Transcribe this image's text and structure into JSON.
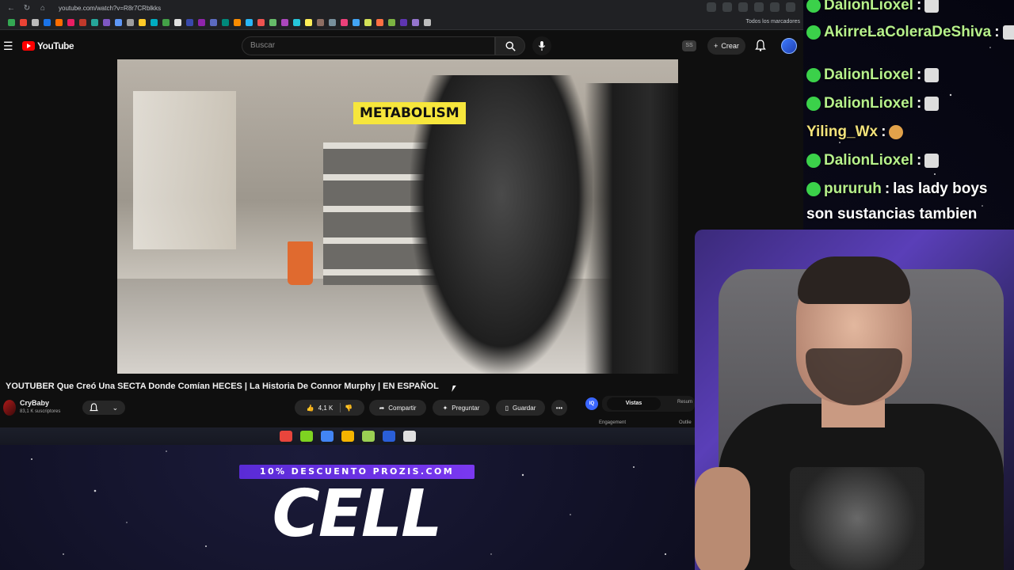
{
  "browser": {
    "url": "youtube.com/watch?v=R8r7CRblkks",
    "bookmarks_all_label": "Todos los marcadores",
    "bookmark_colors": [
      "#34a853",
      "#ea4335",
      "#bbbbbb",
      "#1a73e8",
      "#ff6d00",
      "#e91e63",
      "#c0392b",
      "#26a69a",
      "#7e57c2",
      "#5e97f6",
      "#9e9e9e",
      "#ffca28",
      "#00acc1",
      "#43a047",
      "#e0e0e0",
      "#3949ab",
      "#8e24aa",
      "#5c6bc0",
      "#00897b",
      "#fb8c00",
      "#29b6f6",
      "#ef5350",
      "#66bb6a",
      "#ab47bc",
      "#26c6da",
      "#ffee58",
      "#8d6e63",
      "#78909c",
      "#ec407a",
      "#42a5f5",
      "#d4e157",
      "#ff7043",
      "#7cb342",
      "#5e35b1",
      "#9575cd",
      "#bdbdbd"
    ]
  },
  "youtube": {
    "logo_text": "YouTube",
    "search_placeholder": "Buscar",
    "ss_badge": "SS",
    "create_label": "Crear",
    "video_overlay_text": "METABOLISM",
    "video_title": "YOUTUBER Que Creó Una SECTA Donde Comían HECES | La Historia De Connor Murphy | EN ESPAÑOL",
    "channel_name": "CryBaby",
    "subscribers": "83,1 K suscriptores",
    "likes": "4,1 K",
    "share_label": "Compartir",
    "ask_label": "Preguntar",
    "save_label": "Guardar",
    "more_label": "•••",
    "iq_badge": "IQ",
    "tab_views": "Vistas",
    "tab_summary": "Resum",
    "label_engagement": "Engagement",
    "label_outlier": "Outlie"
  },
  "taskbar": {
    "icon_colors": [
      "#e8453c",
      "#7ed321",
      "#4285f4",
      "#f5b400",
      "#9bcf53",
      "#2a5fd8",
      "#e0e0e0"
    ]
  },
  "promo": {
    "banner_text": "10% DESCUENTO PROZIS.COM",
    "big_text": "CELL"
  },
  "chat": {
    "messages": [
      {
        "user": "DalionLioxel",
        "text": "",
        "name_color": "green"
      },
      {
        "user": "AkirreLaColeraDeShiva",
        "text": "",
        "name_color": "green"
      },
      {
        "user": "DalionLioxel",
        "text": "",
        "name_color": "green"
      },
      {
        "user": "DalionLioxel",
        "text": "",
        "name_color": "green"
      },
      {
        "user": "Yiling_Wx",
        "text": "",
        "name_color": "yellow"
      },
      {
        "user": "DalionLioxel",
        "text": "",
        "name_color": "green"
      },
      {
        "user": "pururuh",
        "text": "las lady boys",
        "name_color": "green"
      }
    ],
    "continuation": "son sustancias tambien"
  }
}
